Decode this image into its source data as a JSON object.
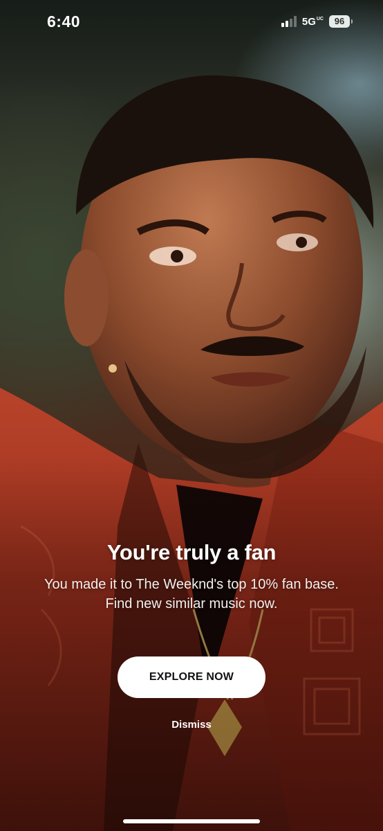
{
  "status_bar": {
    "time": "6:40",
    "network": "5G",
    "network_sub": "UC",
    "battery": "96",
    "signal_bars_filled": 2,
    "signal_bars_total": 4
  },
  "promo": {
    "title": "You're truly a fan",
    "body": "You made it to The Weeknd's top 10% fan base. Find new similar music now.",
    "explore_label": "EXPLORE NOW",
    "dismiss_label": "Dismiss"
  },
  "colors": {
    "button_bg": "#ffffff",
    "button_text": "#121212",
    "text": "#ffffff"
  },
  "icons": {
    "signal": "cellular-signal-icon",
    "battery": "battery-icon"
  }
}
